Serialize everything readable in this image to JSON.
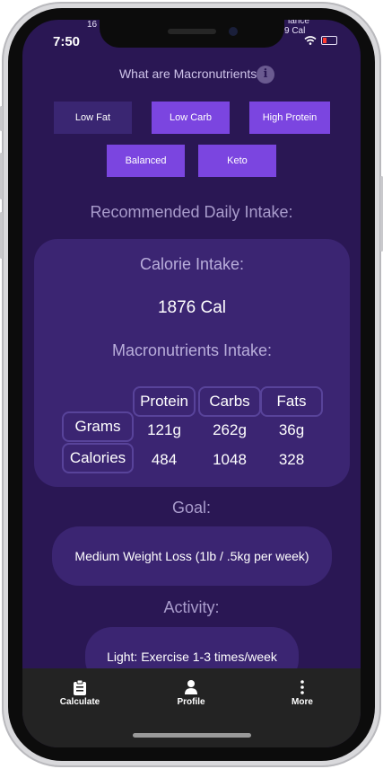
{
  "status_bar": {
    "time": "7:50",
    "peek_left": "16",
    "peek_right_line1": "lance",
    "peek_right_line2": "9 Cal"
  },
  "macro_info": {
    "question": "What are Macronutrients?",
    "info_icon": "info-icon"
  },
  "diets": [
    {
      "label": "Low Fat",
      "selected": false
    },
    {
      "label": "Low Carb",
      "selected": true
    },
    {
      "label": "High Protein",
      "selected": true
    },
    {
      "label": "Balanced",
      "selected": true
    },
    {
      "label": "Keto",
      "selected": true
    }
  ],
  "recommended_title": "Recommended Daily Intake:",
  "calorie": {
    "label": "Calorie Intake:",
    "value": "1876 Cal"
  },
  "macros": {
    "label": "Macronutrients Intake:",
    "columns": [
      "Protein",
      "Carbs",
      "Fats"
    ],
    "rows": [
      {
        "label": "Grams",
        "values": [
          "121g",
          "262g",
          "36g"
        ]
      },
      {
        "label": "Calories",
        "values": [
          "484",
          "1048",
          "328"
        ]
      }
    ]
  },
  "goal": {
    "label": "Goal:",
    "value": "Medium Weight Loss (1lb / .5kg per week)"
  },
  "activity": {
    "label": "Activity:",
    "value": "Light: Exercise 1-3 times/week"
  },
  "tabs": [
    {
      "label": "Calculate",
      "icon": "clipboard-icon"
    },
    {
      "label": "Profile",
      "icon": "person-icon"
    },
    {
      "label": "More",
      "icon": "more-vertical-icon"
    }
  ],
  "colors": {
    "background": "#2a1754",
    "card": "#3b2572",
    "accent": "#7b45e0",
    "tabbar": "#232323"
  }
}
